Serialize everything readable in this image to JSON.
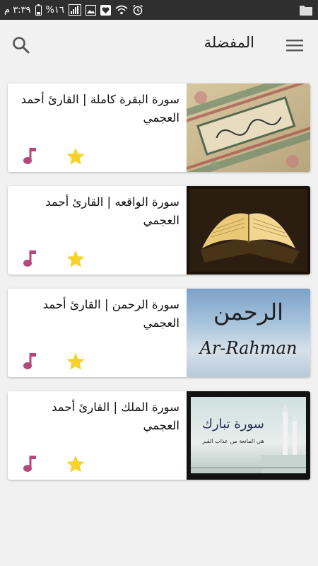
{
  "status_bar": {
    "time": "٣:٣٩ م",
    "battery": "%١٦"
  },
  "app_bar": {
    "title": "المفضلة",
    "menu_icon": "hamburger-menu-icon",
    "search_icon": "search-icon"
  },
  "cards": [
    {
      "title": "سورة البقرة كاملة | القارئ أحمد العجمي",
      "thumbnail": "quran-pages"
    },
    {
      "title": "سورة الواقعه | القارئ أحمد العجمي",
      "thumbnail": "open-book"
    },
    {
      "title": "سورة الرحمن | القارئ أحمد العجمي",
      "thumbnail": "ar-rahman",
      "thumb_ar": "الرحمن",
      "thumb_en": "Ar-Rahman"
    },
    {
      "title": "سورة الملك | القارئ أحمد العجمي",
      "thumbnail": "mosque-card",
      "thumb_ar": "سورة تبارك",
      "thumb_sub": "هي المانعة من عذاب القبر"
    }
  ],
  "colors": {
    "music_icon": "#b5477a",
    "star_icon": "#f6d22b",
    "status_bar": "#2f2f2f",
    "background": "#f1f1f1"
  }
}
